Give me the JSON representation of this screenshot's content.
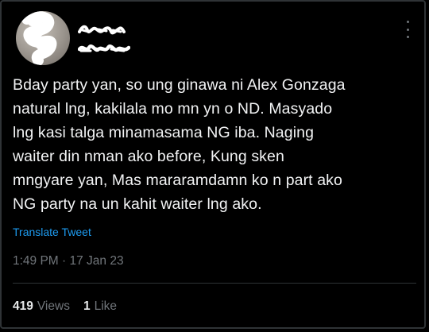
{
  "tweet": {
    "text": "Bday party yan, so ung ginawa ni Alex Gonzaga\nnatural lng, kakilala mo mn yn o ND. Masyado\nlng kasi talga minamasama NG iba. Naging\nwaiter din nman ako before, Kung sken\nmngyare yan, Mas mararamdamn ko n part ako\nNG party na un kahit waiter lng ako.",
    "translate_label": "Translate Tweet",
    "timestamp": "1:49 PM · 17 Jan 23"
  },
  "stats": {
    "views_count": "419",
    "views_label": "Views",
    "likes_count": "1",
    "likes_label": "Like"
  },
  "colors": {
    "background": "#000000",
    "text": "#e7e9ea",
    "secondary_text": "#71767b",
    "link": "#1d9bf0",
    "divider": "#2f3336"
  },
  "icons": {
    "more": "more-horizontal-icon"
  }
}
